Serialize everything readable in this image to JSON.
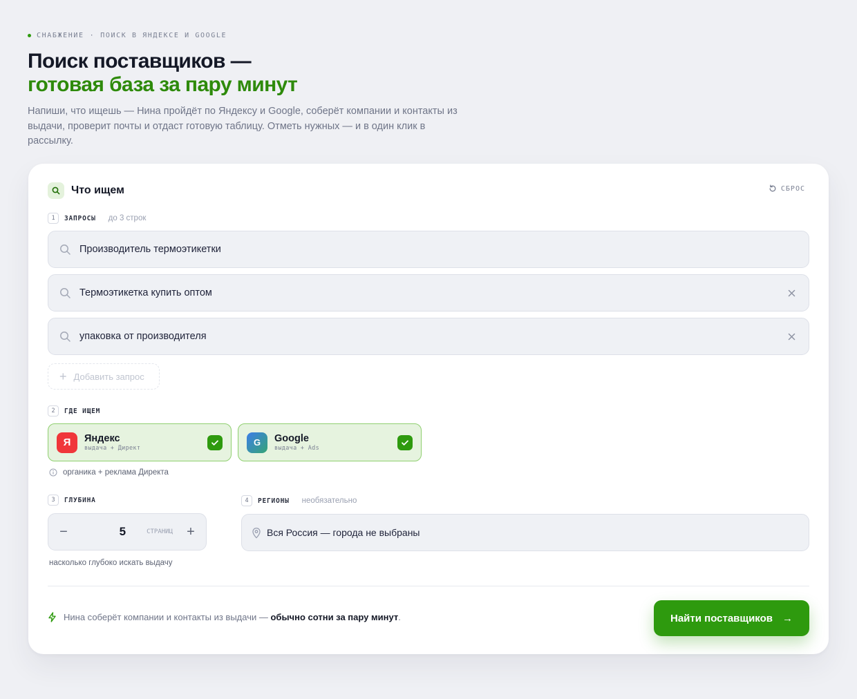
{
  "header": {
    "eyebrow_1": "СНАБЖЕНИЕ",
    "eyebrow_sep": "·",
    "eyebrow_2": "ПОИСК В ЯНДЕКСЕ И GOOGLE",
    "title_line1": "Поиск поставщиков —",
    "title_line2": "готовая база за пару минут",
    "subtitle": "Напиши, что ищешь — Нина пройдёт по Яндексу и Google, соберёт компании и контакты из выдачи, проверит почты и отдаст готовую таблицу. Отметь нужных — и в один клик в рассылку."
  },
  "card": {
    "title": "Что ищем",
    "reset_label": "СБРОС",
    "queries_step": {
      "num": "1",
      "name": "ЗАПРОСЫ",
      "hint": "до 3 строк"
    },
    "queries": [
      {
        "text": "Производитель термоэтикетки",
        "removable": false
      },
      {
        "text": "Термоэтикетка купить оптом",
        "removable": true
      },
      {
        "text": "упаковка от производителя",
        "removable": true
      }
    ],
    "add_query_label": "Добавить запрос",
    "engines_step": {
      "num": "2",
      "name": "ГДЕ ИЩЕМ"
    },
    "engines": [
      {
        "logo": "Я",
        "name": "Яндекс",
        "sub": "выдача + Директ",
        "checked": true
      },
      {
        "logo": "G",
        "name": "Google",
        "sub": "выдача + Ads",
        "checked": true
      }
    ],
    "engines_note": "органика + реклама Директа",
    "depth_step": {
      "num": "3",
      "name": "ГЛУБИНА"
    },
    "depth": {
      "value": "5",
      "unit": "СТРАНИЦ",
      "minus": "−",
      "plus": "+"
    },
    "depth_note": "насколько глубоко искать выдачу",
    "regions_step": {
      "num": "4",
      "name": "РЕГИОНЫ",
      "hint": "необязательно"
    },
    "regions_value": "Вся Россия — города не выбраны",
    "footer_note_prefix": "Нина соберёт компании и контакты из выдачи —",
    "footer_note_bold": "обычно сотни за пару минут",
    "footer_note_suffix": ".",
    "cta_label": "Найти поставщиков",
    "cta_arrow": "→"
  },
  "colors": {
    "accent": "#2e9a0e",
    "accent_text": "#2e8a0b",
    "yandex": "#f0363a",
    "background": "#eff0f4"
  }
}
